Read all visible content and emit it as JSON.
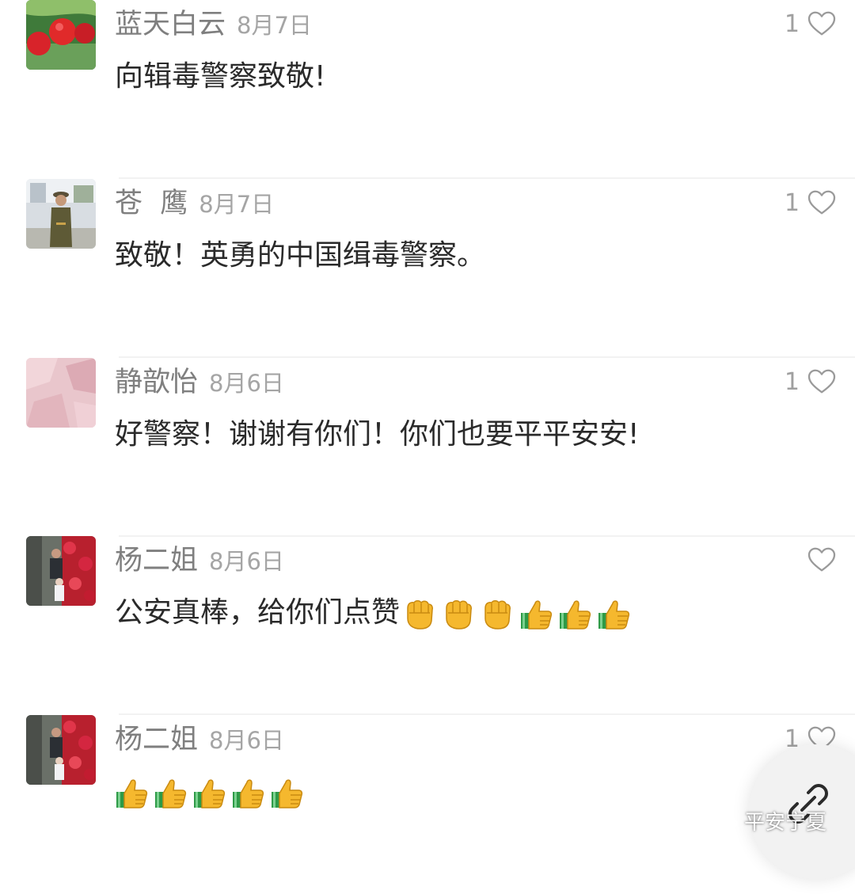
{
  "comments": [
    {
      "name": "蓝天白云",
      "date": "8月7日",
      "text": "向辑毒警察致敬!",
      "likes": "1"
    },
    {
      "name": "苍  鹰",
      "date": "8月7日",
      "text": "致敬！英勇的中国缉毒警察。",
      "likes": "1"
    },
    {
      "name": "静歆怡",
      "date": "8月6日",
      "text": "好警察！谢谢有你们！你们也要平平安安!",
      "likes": "1"
    },
    {
      "name": "杨二姐",
      "date": "8月6日",
      "text": "公安真棒，给你们点赞",
      "likes": "",
      "emoji": [
        "fist-emoji",
        "fist-emoji",
        "fist-emoji",
        "thumbs-up-emoji",
        "thumbs-up-emoji",
        "thumbs-up-emoji"
      ]
    },
    {
      "name": "杨二姐",
      "date": "8月6日",
      "text": "",
      "likes": "1",
      "emoji": [
        "thumbs-up-emoji",
        "thumbs-up-emoji",
        "thumbs-up-emoji",
        "thumbs-up-emoji",
        "thumbs-up-emoji"
      ]
    }
  ],
  "watermark": {
    "text": "平安宁夏"
  },
  "colors": {
    "name": "#7f7f7f",
    "date": "#a5a5a5",
    "text": "#2a2a2a",
    "emoji": "#f5b82e",
    "cuff": "#2e9a47"
  }
}
